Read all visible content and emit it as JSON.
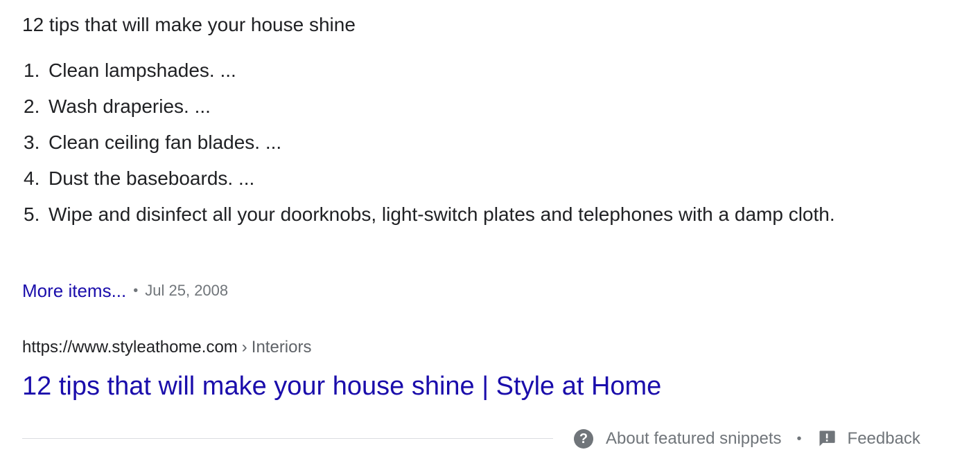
{
  "snippet": {
    "heading": "12 tips that will make your house shine",
    "items": [
      {
        "num": "1.",
        "text": "Clean lampshades. ..."
      },
      {
        "num": "2.",
        "text": "Wash draperies. ..."
      },
      {
        "num": "3.",
        "text": "Clean ceiling fan blades. ..."
      },
      {
        "num": "4.",
        "text": "Dust the baseboards. ..."
      },
      {
        "num": "5.",
        "text": "Wipe and disinfect all your doorknobs, light-switch plates and telephones with a damp cloth."
      }
    ],
    "more_label": "More items...",
    "separator": "•",
    "date": "Jul 25, 2008"
  },
  "result": {
    "url": "https://www.styleathome.com",
    "breadcrumb_separator": "›",
    "breadcrumb": "Interiors",
    "title": "12 tips that will make your house shine | Style at Home"
  },
  "footer": {
    "about_label": "About featured snippets",
    "about_icon": "help-circle-icon",
    "separator": "•",
    "feedback_label": "Feedback",
    "feedback_icon": "feedback-icon"
  },
  "colors": {
    "link": "#1a0dab",
    "text": "#202124",
    "muted": "#70757a",
    "divider": "#dadce0"
  }
}
